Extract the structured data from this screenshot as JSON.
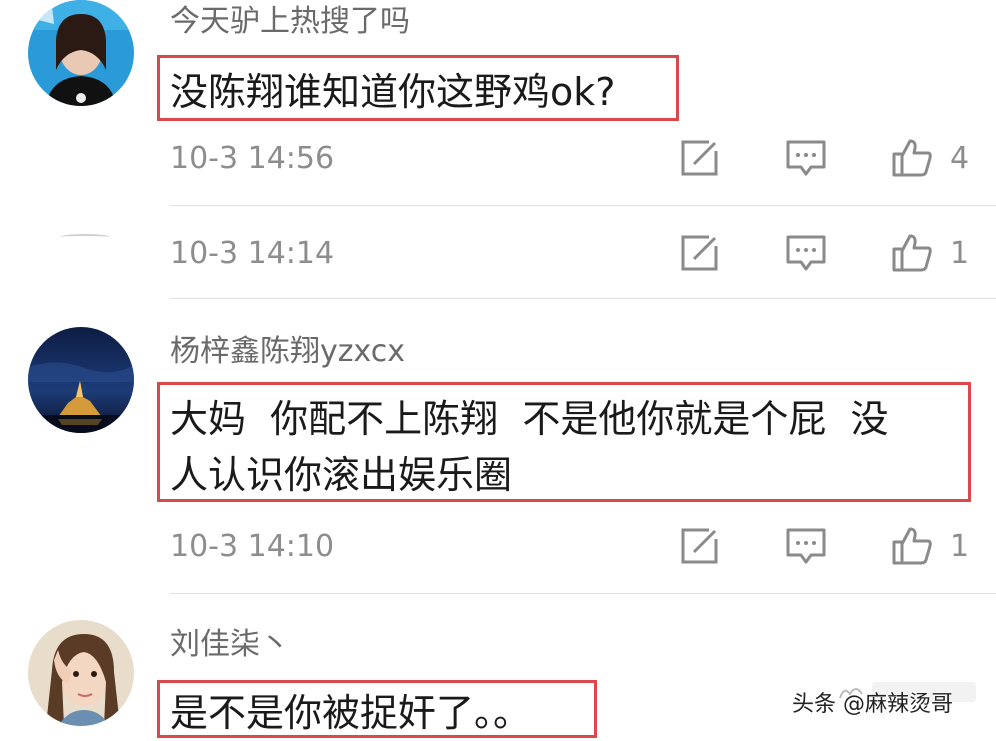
{
  "comments": [
    {
      "username": "今天驴上热搜了吗",
      "content_lines": [
        "没陈翔谁知道你这野鸡ok?"
      ],
      "timestamp": "10-3 14:56",
      "likes": "4",
      "avatar": "girl-portrait-avatar"
    },
    {
      "username": "",
      "content_lines": [],
      "timestamp": "10-3 14:14",
      "likes": "1",
      "avatar": "partial-avatar"
    },
    {
      "username": "杨梓鑫陈翔yzxcx",
      "content_lines": [
        "大妈  你配不上陈翔  不是他你就是个屁  没",
        "人认识你滚出娱乐圈"
      ],
      "timestamp": "10-3 14:10",
      "likes": "1",
      "avatar": "night-castle-avatar"
    },
    {
      "username": "刘佳柒丶",
      "content_lines": [
        "是不是你被捉奸了。。"
      ],
      "timestamp": "",
      "likes": "",
      "avatar": "girl-selfie-avatar"
    }
  ],
  "icons": {
    "edit": "edit-icon",
    "reply": "reply-icon",
    "like": "thumbs-up-icon"
  },
  "watermark": "头条 @麻辣烫哥",
  "colors": {
    "highlight_border": "#d9484a",
    "meta_text": "#8d8d8d",
    "username_text": "#6a6a6a"
  }
}
